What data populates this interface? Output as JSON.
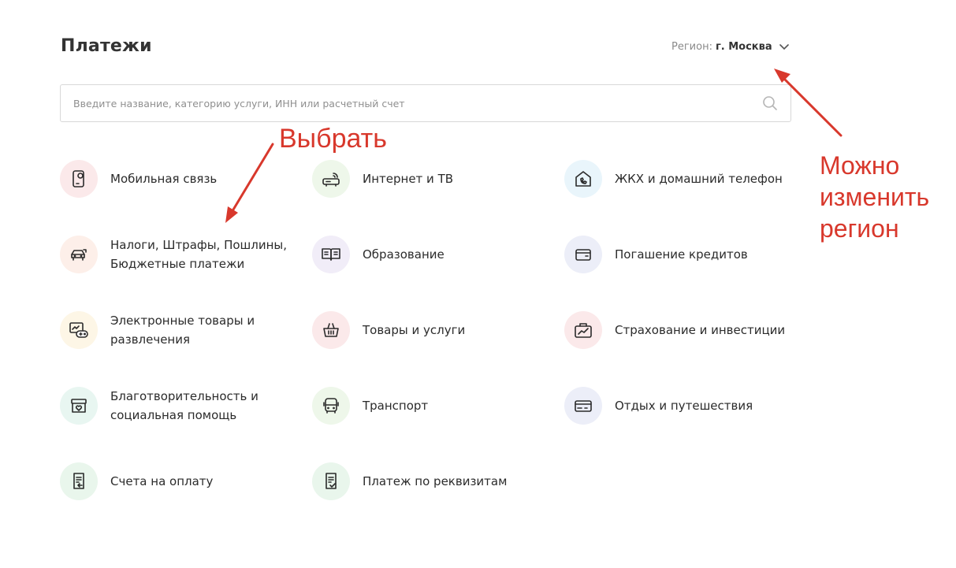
{
  "header": {
    "title": "Платежи",
    "region_label": "Регион:",
    "region_value": "г. Москва"
  },
  "search": {
    "placeholder": "Введите название, категорию услуги, ИНН или расчетный счет"
  },
  "categories": [
    {
      "label": "Мобильная связь",
      "icon": "mobile-phone-icon",
      "bg": "#fbe9ea"
    },
    {
      "label": "Интернет и ТВ",
      "icon": "router-icon",
      "bg": "#eef7ea"
    },
    {
      "label": "ЖКХ и домашний телефон",
      "icon": "house-phone-icon",
      "bg": "#e9f5fb"
    },
    {
      "label": "Налоги, Штрафы, Пошлины, Бюджетные платежи",
      "icon": "car-icon",
      "bg": "#fdefe9"
    },
    {
      "label": "Образование",
      "icon": "book-icon",
      "bg": "#f1edf8"
    },
    {
      "label": "Погашение кредитов",
      "icon": "wallet-icon",
      "bg": "#eceef8"
    },
    {
      "label": "Электронные товары и развлечения",
      "icon": "gamepad-icon",
      "bg": "#fdf6e6"
    },
    {
      "label": "Товары и услуги",
      "icon": "basket-icon",
      "bg": "#fbe9ea"
    },
    {
      "label": "Страхование и инвестиции",
      "icon": "briefcase-chart-icon",
      "bg": "#fbe9ea"
    },
    {
      "label": "Благотворительность и социальная помощь",
      "icon": "charity-box-icon",
      "bg": "#e8f6f1"
    },
    {
      "label": "Транспорт",
      "icon": "bus-icon",
      "bg": "#eef7ea"
    },
    {
      "label": "Отдых и путешествия",
      "icon": "ticket-icon",
      "bg": "#eceef8"
    },
    {
      "label": "Счета на оплату",
      "icon": "bill-icon",
      "bg": "#e9f6ec"
    },
    {
      "label": "Платеж по реквизитам",
      "icon": "document-check-icon",
      "bg": "#e9f6ec"
    }
  ],
  "annotations": {
    "select": "Выбрать",
    "region_line1": "Можно",
    "region_line2": "изменить",
    "region_line3": "регион"
  },
  "colors": {
    "annotation": "#d8382c",
    "icon_stroke": "#2b2b2b"
  }
}
